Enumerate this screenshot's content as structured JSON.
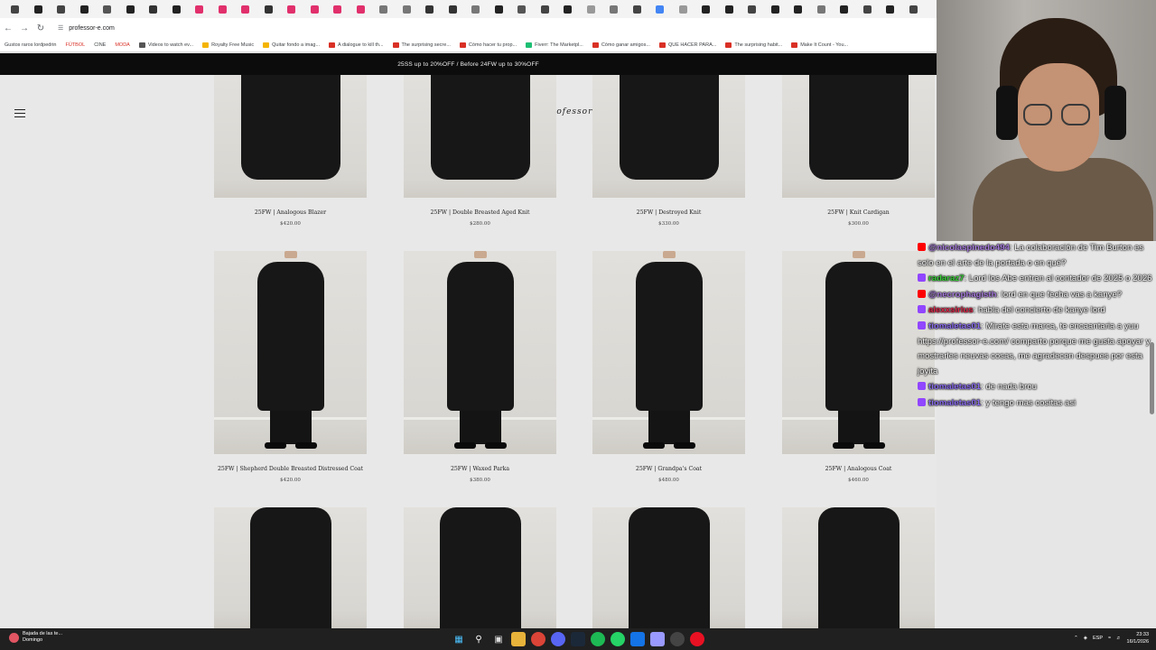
{
  "browser": {
    "tabs": [
      "M",
      "M",
      "M",
      "M",
      "M",
      "M",
      "M",
      "M",
      "M",
      "M",
      "M",
      "M",
      "M",
      "M",
      "M",
      "M",
      "M",
      "M",
      "M",
      "M",
      "M",
      "M",
      "M",
      "M",
      "M",
      "M",
      "M",
      "M",
      "M",
      "M",
      "M",
      "M",
      "M",
      "M",
      "M",
      "M",
      "M",
      "M",
      "M",
      "M"
    ],
    "tab_colors": [
      "#444",
      "#222",
      "#444",
      "#222",
      "#555",
      "#222",
      "#333",
      "#222",
      "#e1306c",
      "#e1306c",
      "#e1306c",
      "#333",
      "#e1306c",
      "#e1306c",
      "#e1306c",
      "#e1306c",
      "#777",
      "#777",
      "#333",
      "#333",
      "#777",
      "#222",
      "#555",
      "#444",
      "#222",
      "#999",
      "#777",
      "#444",
      "#4285f4",
      "#999",
      "#222",
      "#222",
      "#444",
      "#222",
      "#222",
      "#777",
      "#222",
      "#444",
      "#222",
      "#444"
    ],
    "url": "professor-e.com",
    "bookmarks": [
      {
        "label": "Gustos raros lordpedrin",
        "color": ""
      },
      {
        "label": "FÚTBOL",
        "color": "tag"
      },
      {
        "label": "CINE",
        "color": ""
      },
      {
        "label": "MODA",
        "color": "tag"
      },
      {
        "label": "Videos to watch ev...",
        "color": "#555"
      },
      {
        "label": "Royalty Free Music",
        "color": "#f4b400"
      },
      {
        "label": "Quitar fondo a imag...",
        "color": "#f4b400"
      },
      {
        "label": "A dialogue to kill th...",
        "color": "#d93025"
      },
      {
        "label": "The surprising secre...",
        "color": "#d93025"
      },
      {
        "label": "Cómo hacer tu prop...",
        "color": "#d93025"
      },
      {
        "label": "Fiverr: The Marketpl...",
        "color": "#1dbf73"
      },
      {
        "label": "Cómo ganar amigos...",
        "color": "#d93025"
      },
      {
        "label": "QUE HACER PARA...",
        "color": "#d93025"
      },
      {
        "label": "The surprising habit...",
        "color": "#d93025"
      },
      {
        "label": "Make It Count - You...",
        "color": "#d93025"
      }
    ]
  },
  "page": {
    "promo": "25SS up to 20%OFF  /  Before 24FW up to 30%OFF",
    "logo": "Professor E",
    "products": [
      {
        "name": "25FW | Analogous Blazer",
        "price": "$420.00"
      },
      {
        "name": "25FW | Double Breasted Aged Knit",
        "price": "$280.00"
      },
      {
        "name": "25FW | Destroyed Knit",
        "price": "$330.00"
      },
      {
        "name": "25FW | Knit Cardigan",
        "price": "$300.00"
      },
      {
        "name": "25FW | Shepherd Double Breasted Distressed Coat",
        "price": "$420.00"
      },
      {
        "name": "25FW | Waxed Parka",
        "price": "$380.00"
      },
      {
        "name": "25FW | Grandpa's Coat",
        "price": "$480.00"
      },
      {
        "name": "25FW | Analogous Coat",
        "price": "$460.00"
      },
      {
        "name": "",
        "price": ""
      },
      {
        "name": "",
        "price": ""
      },
      {
        "name": "",
        "price": ""
      },
      {
        "name": "",
        "price": ""
      }
    ]
  },
  "chat": [
    {
      "badge": "#ff0000",
      "user": "@nicolaspinedo494",
      "user_color": "#a67bdc",
      "text": ": La colaboración de Tim Burton es solo en el arte de la portada o en qué?"
    },
    {
      "badge": "#9146ff",
      "user": "radaraz7",
      "user_color": "#3ad13a",
      "text": ": Lord los Abe entran al contador de 2025 o 2026"
    },
    {
      "badge": "#ff0000",
      "user": "@necrophagisth",
      "user_color": "#a67bdc",
      "text": ": lord en que fecha vas a kanye?"
    },
    {
      "badge": "#9146ff",
      "user": "alexxsirius",
      "user_color": "#e0264a",
      "text": ": habla del concierto de kanye lord"
    },
    {
      "badge": "#9146ff",
      "user": "tiomaletas01",
      "user_color": "#8a6cf0",
      "text": ": Mirate esta marca, te encaantaria a yuu https://professor-e.com/ comparto porque me gusta apoyar y mostrarles neuvas cosas, me agradecen despues por esta joyita"
    },
    {
      "badge": "#9146ff",
      "user": "tiomaletas01",
      "user_color": "#8a6cf0",
      "text": ": de nada brou"
    },
    {
      "badge": "#9146ff",
      "user": "tiomaletas01",
      "user_color": "#8a6cf0",
      "text": ": y tengo mas cositas asi"
    }
  ],
  "taskbar": {
    "weather_title": "Bajada de las te...",
    "weather_sub": "Domingo",
    "lang": "ESP",
    "time": "23:33",
    "date": "16/1/2026"
  }
}
